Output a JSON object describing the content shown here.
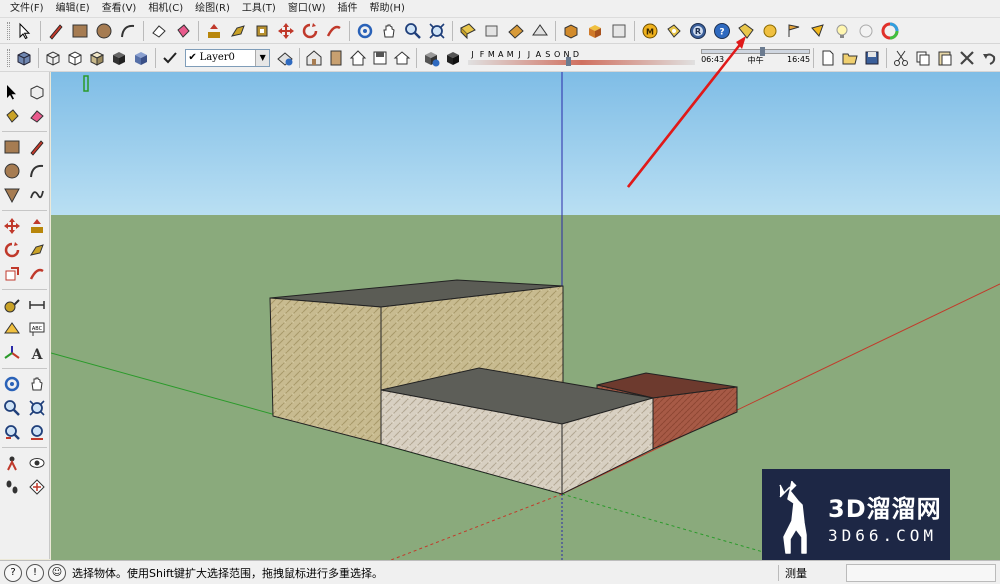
{
  "menu": [
    "文件(F)",
    "编辑(E)",
    "查看(V)",
    "相机(C)",
    "绘图(R)",
    "工具(T)",
    "窗口(W)",
    "插件",
    "帮助(H)"
  ],
  "toolbar": {
    "layer_selected": "Layer0",
    "months": [
      "J",
      "F",
      "M",
      "A",
      "M",
      "J",
      "J",
      "A",
      "S",
      "O",
      "N",
      "D"
    ],
    "time_start": "06:43",
    "time_mid": "中午",
    "time_end": "16:45",
    "ruby_console_label": "R"
  },
  "status": {
    "message": "选择物体。使用Shift键扩大选择范围，拖拽鼠标进行多重选择。",
    "measure_label": "测量",
    "measure_value": ""
  },
  "watermark": {
    "title": "3D溜溜网",
    "subtitle": "3D66.COM"
  },
  "colors": {
    "sky": "#8fc8ea",
    "ground": "#8aaa7c",
    "red_axis": "#c23a2a",
    "green_axis": "#2a9a2a",
    "blue_axis": "#2a2aa8",
    "annotation_arrow": "#e01a1a",
    "watermark_bg": "#1d2745"
  },
  "icons": {
    "toolbar_1": [
      "select-arrow-icon",
      "pencil-icon",
      "rectangle-icon",
      "circle-icon",
      "arc-icon",
      "eraser-icon",
      "paint-bucket-icon",
      "push-pull-icon",
      "follow-me-icon",
      "move-icon",
      "rotate-icon",
      "offset-icon",
      "orbit-icon",
      "pan-icon",
      "zoom-icon",
      "zoom-extents-icon",
      "section-plane-icon",
      "section-display-icon",
      "dimensions-icon",
      "protractor-icon",
      "components-icon",
      "materials-icon",
      "scenes-icon",
      "m-sphere-icon",
      "outliner-icon",
      "ruby-console-icon",
      "help-icon",
      "tag-icon",
      "circle-dot-icon",
      "flag-icon",
      "arrow-flag-icon",
      "bulb-icon",
      "sun-icon",
      "color-wheel-icon"
    ],
    "toolbar_2": [
      "iso-view-icon",
      "top-view-icon",
      "front-view-icon",
      "right-view-icon",
      "back-view-icon",
      "left-view-icon",
      "xray-icon",
      "wireframe-icon",
      "hidden-line-icon",
      "shaded-icon",
      "shaded-texture-icon",
      "layer-manager-icon",
      "warehouse-icon",
      "door-icon",
      "house-icon",
      "save-icon",
      "share-icon",
      "shadow-settings-icon",
      "shadow-toggle-icon",
      "new-icon",
      "open-icon",
      "save-disk-icon",
      "cut-icon",
      "copy-icon",
      "paste-icon",
      "delete-icon",
      "undo-icon"
    ],
    "status": [
      "help-circle-icon",
      "info-circle-icon",
      "user-circle-icon"
    ]
  }
}
